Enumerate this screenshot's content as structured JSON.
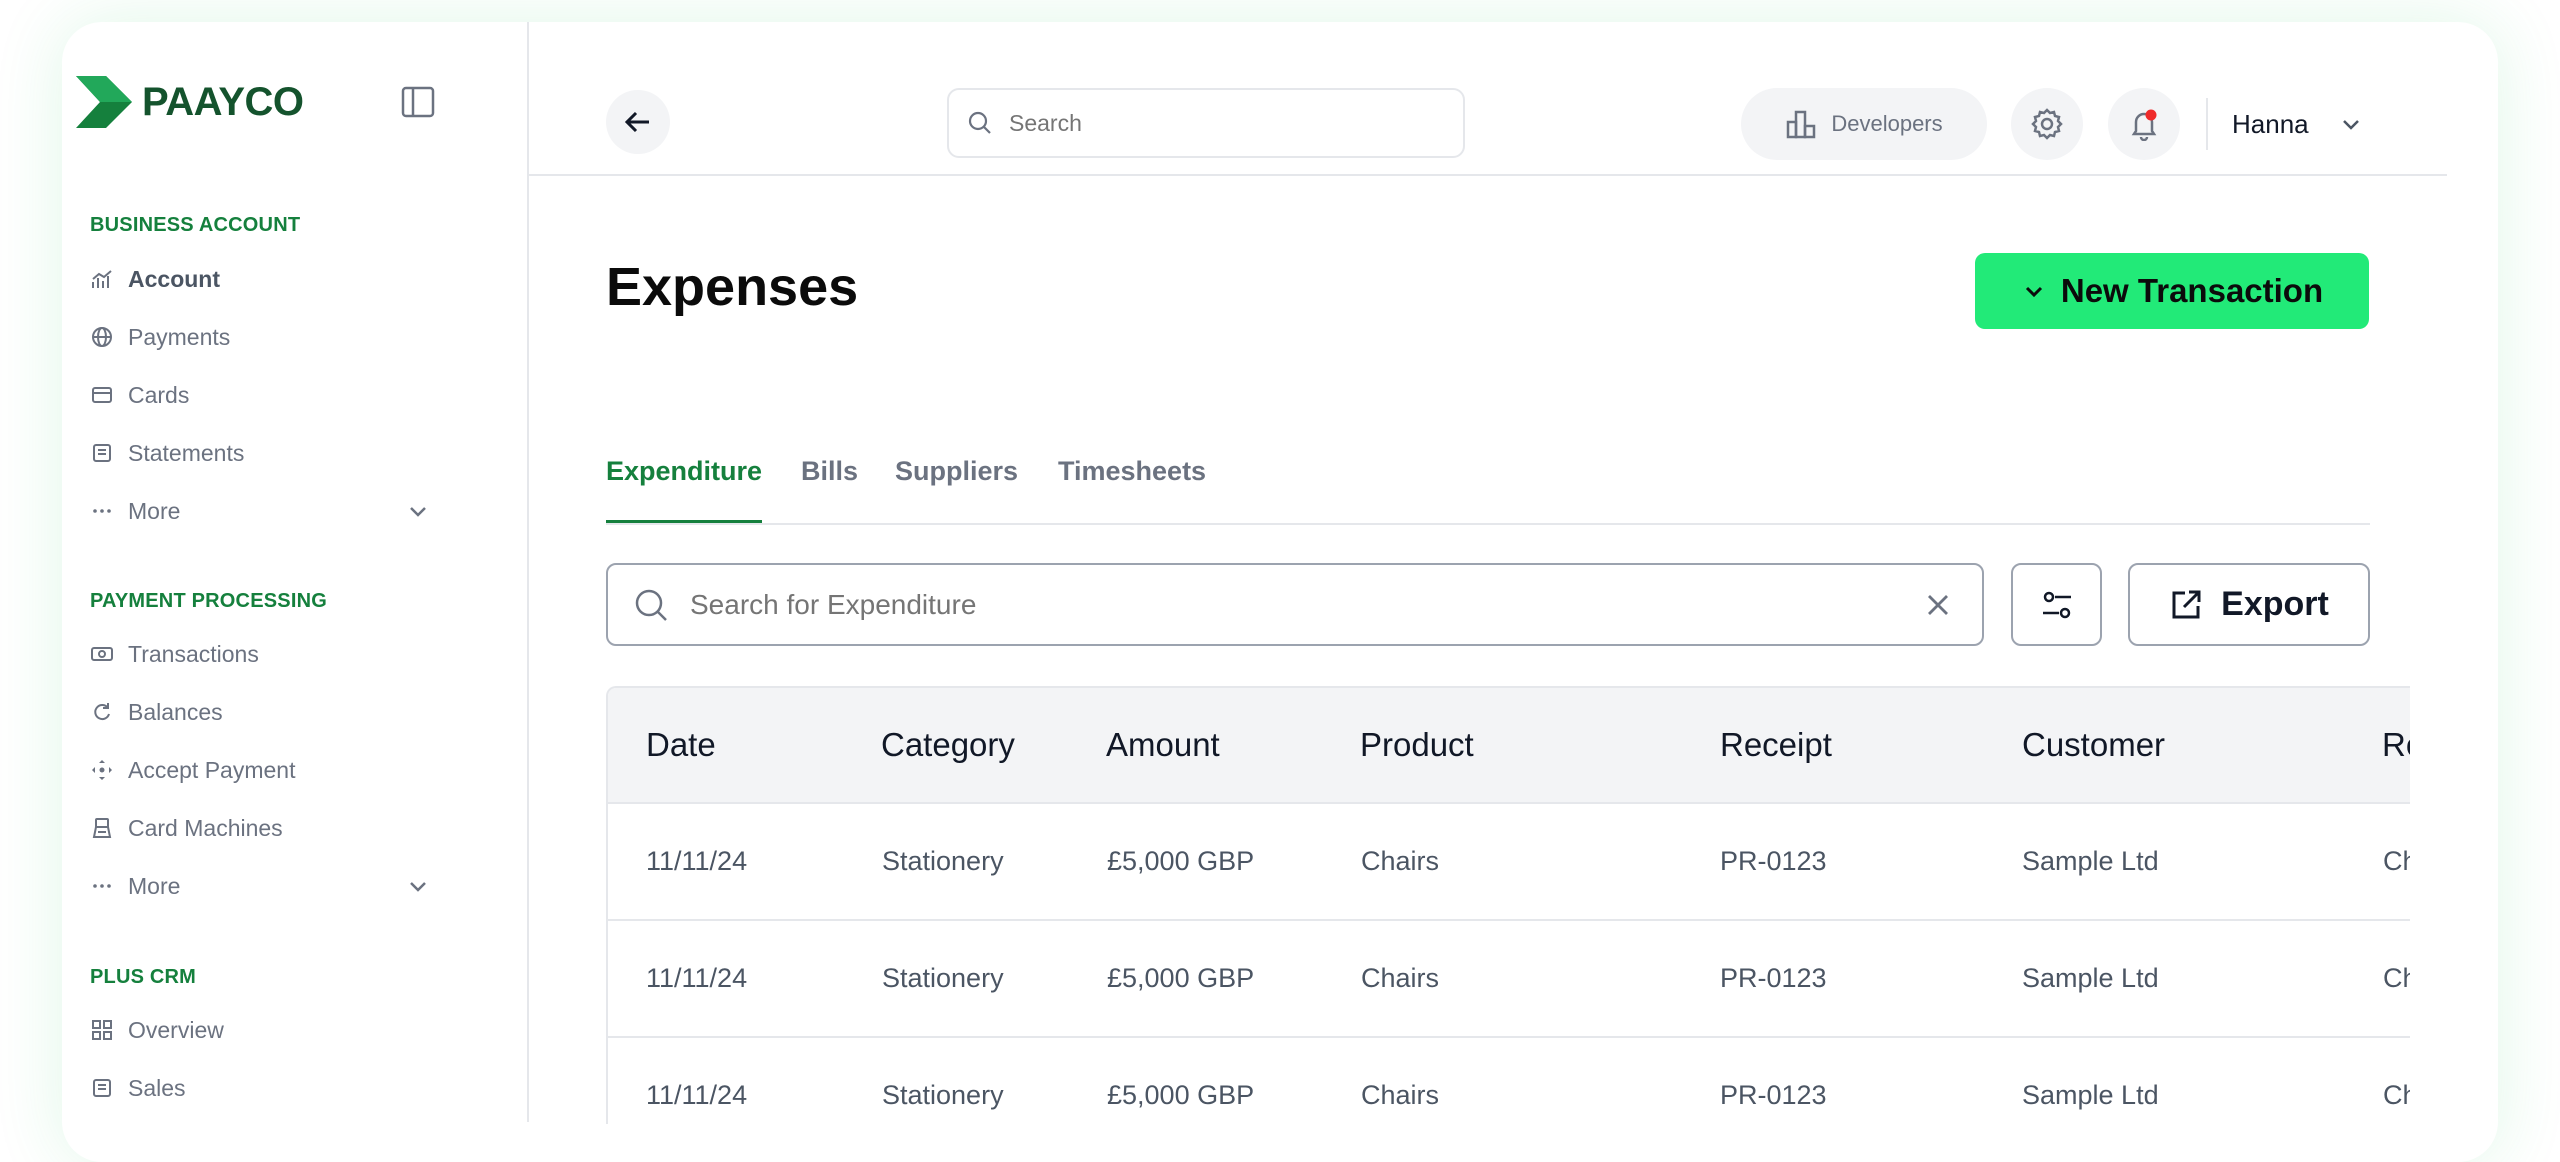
{
  "brand": {
    "name": "PAAYCO"
  },
  "sidebar": {
    "sections": [
      {
        "title": "BUSINESS ACCOUNT",
        "items": [
          {
            "label": "Account",
            "icon": "chart-icon"
          },
          {
            "label": "Payments",
            "icon": "globe-icon"
          },
          {
            "label": "Cards",
            "icon": "card-icon"
          },
          {
            "label": "Statements",
            "icon": "document-icon"
          },
          {
            "label": "More",
            "icon": "ellipsis-icon",
            "expandable": true
          }
        ]
      },
      {
        "title": "PAYMENT PROCESSING",
        "items": [
          {
            "label": "Transactions",
            "icon": "cash-icon"
          },
          {
            "label": "Balances",
            "icon": "refresh-icon"
          },
          {
            "label": "Accept Payment",
            "icon": "move-icon"
          },
          {
            "label": "Card Machines",
            "icon": "terminal-icon"
          },
          {
            "label": "More",
            "icon": "ellipsis-icon",
            "expandable": true
          }
        ]
      },
      {
        "title": "PLUS CRM",
        "items": [
          {
            "label": "Overview",
            "icon": "grid-icon"
          },
          {
            "label": "Sales",
            "icon": "document-icon"
          }
        ]
      }
    ]
  },
  "topbar": {
    "search_placeholder": "Search",
    "developers_label": "Developers",
    "user_name": "Hanna"
  },
  "page": {
    "title": "Expenses",
    "new_transaction_label": "New Transaction",
    "tabs": [
      {
        "label": "Expenditure",
        "active": true
      },
      {
        "label": "Bills",
        "active": false
      },
      {
        "label": "Suppliers",
        "active": false
      },
      {
        "label": "Timesheets",
        "active": false
      }
    ],
    "search_placeholder": "Search for Expenditure",
    "export_label": "Export"
  },
  "colors": {
    "accent": "#15803d",
    "button_green": "#22ea78",
    "notification_dot": "#ef2a2a"
  },
  "table": {
    "columns": [
      "Date",
      "Category",
      "Amount",
      "Product",
      "Receipt",
      "Customer",
      "Re"
    ],
    "rows": [
      [
        "11/11/24",
        "Stationery",
        "£5,000 GBP",
        "Chairs",
        "PR-0123",
        "Sample Ltd",
        "Ch"
      ],
      [
        "11/11/24",
        "Stationery",
        "£5,000 GBP",
        "Chairs",
        "PR-0123",
        "Sample Ltd",
        "Ch"
      ],
      [
        "11/11/24",
        "Stationery",
        "£5,000 GBP",
        "Chairs",
        "PR-0123",
        "Sample Ltd",
        "Ch"
      ]
    ]
  }
}
